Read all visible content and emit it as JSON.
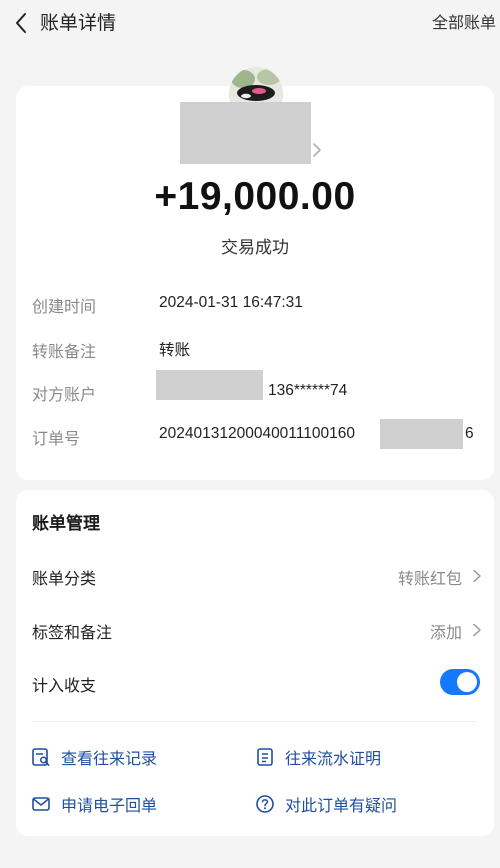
{
  "header": {
    "title": "账单详情",
    "right_link": "全部账单"
  },
  "detail": {
    "amount": "+19,000.00",
    "status": "交易成功",
    "fields": [
      {
        "label": "创建时间",
        "value": "2024-01-31 16:47:31"
      },
      {
        "label": "转账备注",
        "value": "转账"
      },
      {
        "label": "对方账户",
        "value": "136******74"
      },
      {
        "label": "订单号",
        "value": "20240131200040011100160",
        "suffix": "6"
      }
    ]
  },
  "manage": {
    "title": "账单管理",
    "rows": [
      {
        "label": "账单分类",
        "value": "转账红包"
      },
      {
        "label": "标签和备注",
        "value": "添加"
      },
      {
        "label": "计入收支",
        "toggle_on": true
      }
    ],
    "actions": [
      {
        "label": "查看往来记录",
        "icon": "search-records-icon"
      },
      {
        "label": "往来流水证明",
        "icon": "statement-proof-icon"
      },
      {
        "label": "申请电子回单",
        "icon": "mail-icon"
      },
      {
        "label": "对此订单有疑问",
        "icon": "question-icon"
      }
    ]
  },
  "colors": {
    "accent": "#1677ff",
    "action_text": "#1f4fa0",
    "background": "#f4f4f4"
  }
}
